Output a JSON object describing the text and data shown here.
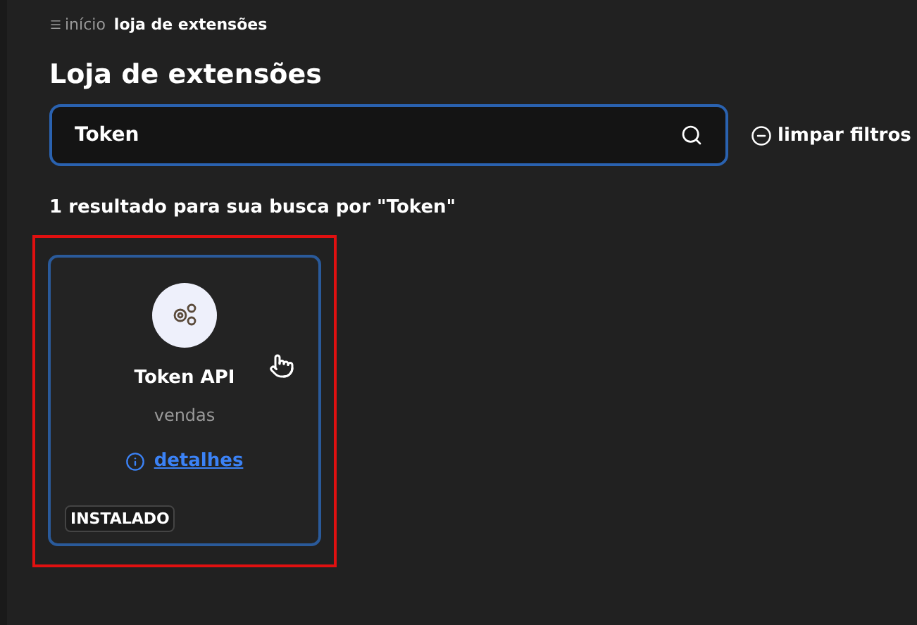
{
  "breadcrumb": {
    "items": [
      {
        "label": "início",
        "selected": false
      },
      {
        "label": "loja de extensões",
        "selected": true
      }
    ]
  },
  "title": "Loja de extensões",
  "search": {
    "value": "Token"
  },
  "clear_filters": "limpar filtros",
  "result_text": "1 resultado para sua busca por \"Token\"",
  "cards": [
    {
      "name": "Token API",
      "category": "vendas",
      "details": "detalhes",
      "badge": "INSTALADO",
      "highlighted": true
    }
  ]
}
